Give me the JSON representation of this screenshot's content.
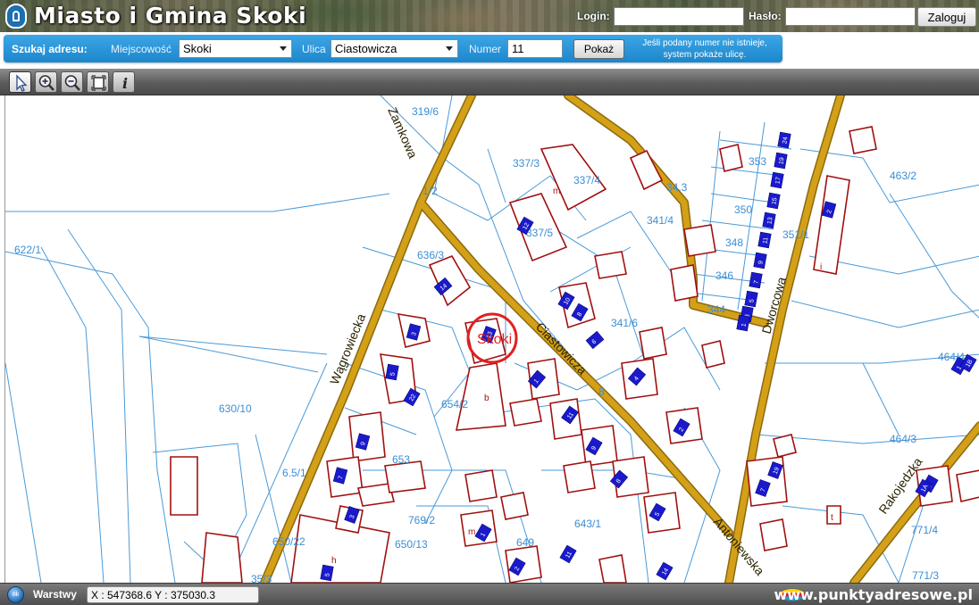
{
  "header": {
    "title": "Miasto i Gmina Skoki",
    "login_label": "Login:",
    "login_value": "",
    "password_label": "Hasło:",
    "password_value": "",
    "login_button": "Zaloguj"
  },
  "search": {
    "heading": "Szukaj adresu:",
    "town_label": "Miejscowość",
    "town_value": "Skoki",
    "street_label": "Ulica",
    "street_value": "Ciastowicza",
    "number_label": "Numer",
    "number_value": "11",
    "show_button": "Pokaż",
    "hint": "Jeśli podany numer nie istnieje, system pokaże ulicę."
  },
  "toolbar": {
    "tools": [
      "select-arrow-icon",
      "zoom-in-icon",
      "zoom-out-icon",
      "full-extent-icon",
      "info-icon"
    ],
    "active_tool": "select-arrow-icon"
  },
  "map": {
    "streets": [
      "Zamkowa",
      "Wągrowiecka",
      "Ciastowicza",
      "Dworcowa",
      "Antoniewska",
      "Rakojedzka"
    ],
    "locality_marker": "Skoki",
    "parcel_labels": [
      "319/6",
      "337/3",
      "337/4",
      "341/4",
      "341/6",
      "353",
      "350",
      "348",
      "346",
      "344",
      "351/1",
      "463/2",
      "622/1",
      "636/3",
      "337/5",
      "630/10",
      "654/2",
      "653",
      "769/2",
      "650/13",
      "650/22",
      "649",
      "643/1",
      "771/4",
      "771/3",
      "464/4",
      "464/3",
      "35/3",
      "6.5/1",
      "34.3",
      "1/2",
      "8"
    ],
    "house_numbers": [
      "24",
      "19",
      "17",
      "15",
      "13",
      "11",
      "9",
      "7",
      "5",
      "3",
      "1",
      "2",
      "12",
      "10",
      "8",
      "6",
      "4",
      "2",
      "9",
      "7",
      "5",
      "3",
      "1",
      "14",
      "13",
      "11",
      "9",
      "8",
      "5",
      "1",
      "9",
      "7",
      "5",
      "3",
      "2",
      "1",
      "14",
      "11",
      "19",
      "22",
      "1B",
      "1A"
    ],
    "colors": {
      "road": "#d4a017",
      "road_edge": "#a07b10",
      "parcel": "#4a9ad8",
      "building": "#a01010",
      "house": "#1a1acc",
      "marker": "#e02020"
    }
  },
  "status": {
    "layers_icon_text": "ok",
    "layers_label": "Warstwy",
    "coordinates": "X : 547368.6  Y : 375030.3",
    "site": "www.punktyadresowe.pl"
  }
}
